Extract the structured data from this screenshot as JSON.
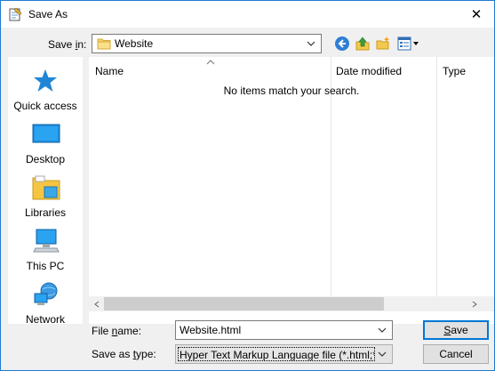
{
  "window": {
    "title": "Save As",
    "close_glyph": "✕"
  },
  "save_in": {
    "label_prefix": "Save ",
    "label_ul": "i",
    "label_suffix": "n:",
    "value": "Website",
    "folder_icon": "folder-icon"
  },
  "toolbar": {
    "icons": [
      "back-icon",
      "up-folder-icon",
      "new-folder-icon",
      "view-menu-icon"
    ]
  },
  "places": [
    {
      "id": "quick-access",
      "label": "Quick access",
      "icon": "star-icon"
    },
    {
      "id": "desktop",
      "label": "Desktop",
      "icon": "desktop-icon"
    },
    {
      "id": "libraries",
      "label": "Libraries",
      "icon": "libraries-icon"
    },
    {
      "id": "this-pc",
      "label": "This PC",
      "icon": "computer-icon"
    },
    {
      "id": "network",
      "label": "Network",
      "icon": "network-icon"
    }
  ],
  "file_list": {
    "columns": [
      {
        "label": "Name"
      },
      {
        "label": "Date modified"
      },
      {
        "label": "Type"
      }
    ],
    "empty_message": "No items match your search."
  },
  "file_name": {
    "label_prefix": "File ",
    "label_ul": "n",
    "label_suffix": "ame:",
    "value": "Website.html"
  },
  "save_as_type": {
    "label_prefix": "Save as ",
    "label_ul": "t",
    "label_suffix": "ype:",
    "value": "Hyper Text Markup Language file (*.html;*.htm;"
  },
  "buttons": {
    "save_ul": "S",
    "save_rest": "ave",
    "cancel": "Cancel"
  },
  "colors": {
    "accent": "#0078d7",
    "window_border": "#1f7ad0"
  }
}
